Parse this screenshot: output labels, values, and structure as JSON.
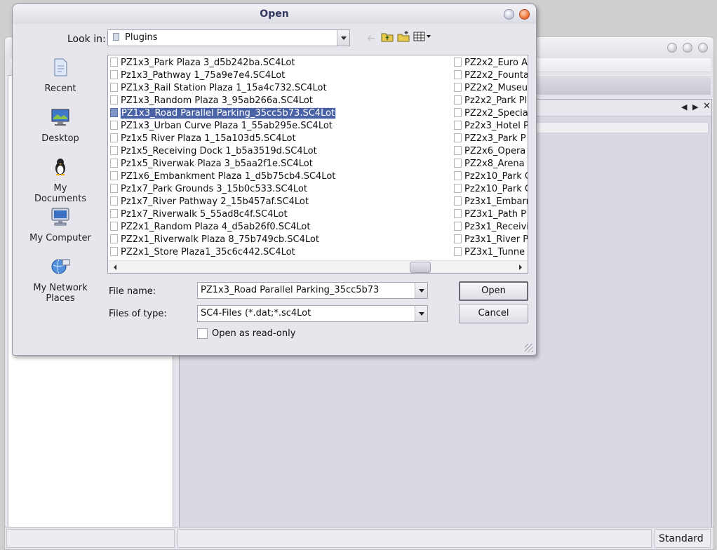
{
  "status_bar": {
    "mode": "Standard"
  },
  "dialog": {
    "title": "Open",
    "look_in": {
      "label": "Look in:",
      "value": "Plugins"
    },
    "places": [
      {
        "label": "Recent",
        "icon": "recent-icon"
      },
      {
        "label": "Desktop",
        "icon": "desktop-icon"
      },
      {
        "label": "My Documents",
        "icon": "my-documents-icon"
      },
      {
        "label": "My Computer",
        "icon": "my-computer-icon"
      },
      {
        "label": "My Network Places",
        "icon": "my-network-places-icon"
      }
    ],
    "files_col1": [
      "PZ1x3_Park Plaza 3_d5b242ba.SC4Lot",
      "Pz1x3_Pathway 1_75a9e7e4.SC4Lot",
      "PZ1x3_Rail Station Plaza 1_15a4c732.SC4Lot",
      "PZ1x3_Random Plaza 3_95ab266a.SC4Lot",
      "PZ1x3_Road Parallel Parking_35cc5b73.SC4Lot",
      "PZ1x3_Urban Curve Plaza 1_55ab295e.SC4Lot",
      "Pz1x5 River Plaza 1_15a103d5.SC4Lot",
      "Pz1x5_Receiving Dock 1_b5a3519d.SC4Lot",
      "Pz1x5_Riverwak Plaza 3_b5aa2f1e.SC4Lot",
      "PZ1x6_Embankment Plaza 1_d5b75cb4.SC4Lot",
      "Pz1x7_Park Grounds 3_15b0c533.SC4Lot",
      "Pz1x7_River Pathway 2_15b457af.SC4Lot",
      "Pz1x7_Riverwalk 5_55ad8c4f.SC4Lot",
      "PZ2x1_Random Plaza 4_d5ab26f0.SC4Lot",
      "PZ2x1_Riverwalk Plaza 8_75b749cb.SC4Lot",
      "PZ2x1_Store Plaza1_35c6c442.SC4Lot"
    ],
    "files_col2": [
      "PZ2x2_Euro A",
      "PZ2x2_Founta",
      "PZ2x2_Museu",
      "Pz2x2_Park Pl",
      "PZ2x2_Special",
      "Pz2x3_Hotel P",
      "PZ2x3_Park P",
      "PZ2x6_Opera",
      "PZ2x8_Arena",
      "Pz2x10_Park G",
      "Pz2x10_Park G",
      "Pz3x1_Embarr",
      "PZ3x1_Path P",
      "Pz3x1_Receivi",
      "Pz3x1_River P",
      "PZ3x1_Tunne"
    ],
    "selected_index": 4,
    "file_name": {
      "label": "File name:",
      "value": "PZ1x3_Road Parallel Parking_35cc5b73"
    },
    "files_of_type": {
      "label": "Files of type:",
      "value": "SC4-Files (*.dat;*.sc4Lot"
    },
    "read_only": {
      "label": "Open as read-only",
      "checked": false
    },
    "open_button": "Open",
    "cancel_button": "Cancel"
  }
}
